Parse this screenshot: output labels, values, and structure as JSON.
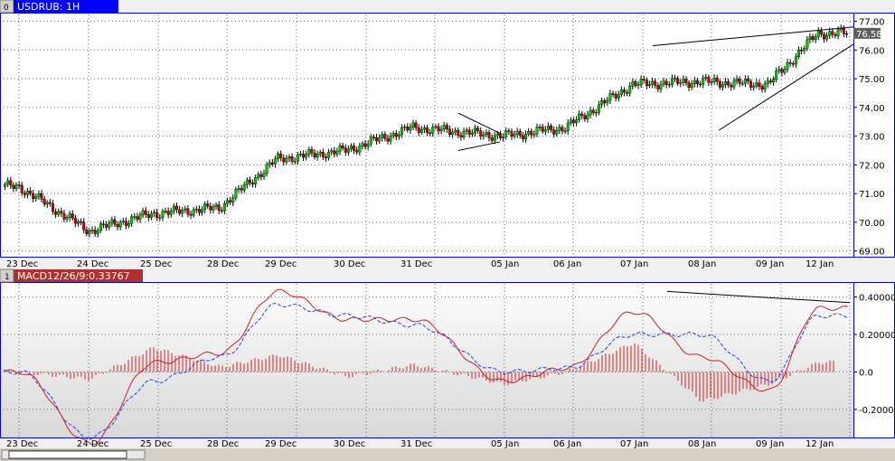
{
  "colors": {
    "up": "#00cc00",
    "down": "#cc0000",
    "border": "#0000cc",
    "tab": "#0000ff",
    "macd_tab": "#b03030",
    "macd_line": "#cc2020",
    "signal_line": "#2040ff",
    "histogram": "#cc2020",
    "trendline": "#000000",
    "price_badge": "#606060"
  },
  "panes": [
    {
      "index": "0",
      "tab_label": "USDRUB: 1H"
    },
    {
      "index": "1",
      "tab_label": "MACD12/26/9:0.33767"
    }
  ],
  "current_price_label": "76.58",
  "date_labels": [
    "23 Dec",
    "24 Dec",
    "25 Dec",
    "28 Dec",
    "29 Dec",
    "30 Dec",
    "31 Dec",
    "05 Jan",
    "06 Jan",
    "07 Jan",
    "08 Jan",
    "09 Jan",
    "12 Jan"
  ],
  "chart_data": [
    {
      "type": "candlestick",
      "title": "USDRUB: 1H",
      "x": [
        "23 Dec",
        "24 Dec",
        "25 Dec",
        "28 Dec",
        "29 Dec",
        "30 Dec",
        "31 Dec",
        "05 Jan",
        "06 Jan",
        "07 Jan",
        "08 Jan",
        "09 Jan",
        "12 Jan"
      ],
      "close_by_label": [
        71.25,
        69.7,
        70.3,
        70.5,
        72.2,
        72.5,
        73.3,
        73.0,
        73.3,
        74.8,
        74.9,
        74.8,
        76.58
      ],
      "ylim": [
        68.8,
        77.3
      ],
      "y_ticks": [
        "69.00",
        "70.00",
        "71.00",
        "72.00",
        "73.00",
        "74.00",
        "75.00",
        "76.00",
        "77.00"
      ],
      "last_price": 76.58,
      "grid": true
    },
    {
      "type": "line",
      "title": "MACD12/26/9:0.33767",
      "x": [
        "23 Dec",
        "24 Dec",
        "25 Dec",
        "28 Dec",
        "29 Dec",
        "30 Dec",
        "31 Dec",
        "05 Jan",
        "06 Jan",
        "07 Jan",
        "08 Jan",
        "09 Jan",
        "12 Jan"
      ],
      "series": [
        {
          "name": "MACD",
          "values": [
            0.0,
            -0.38,
            0.05,
            0.1,
            0.43,
            0.28,
            0.28,
            -0.05,
            0.02,
            0.32,
            0.08,
            -0.1,
            0.34
          ]
        },
        {
          "name": "Signal",
          "values": [
            0.0,
            -0.35,
            -0.05,
            0.08,
            0.36,
            0.3,
            0.25,
            0.0,
            0.02,
            0.2,
            0.2,
            -0.05,
            0.3
          ]
        }
      ],
      "ylim": [
        -0.35,
        0.48
      ],
      "y_ticks": [
        "0.40000",
        "0.20000",
        "0.0",
        "-0.20000"
      ],
      "macd_value": 0.33767,
      "grid": true
    }
  ]
}
